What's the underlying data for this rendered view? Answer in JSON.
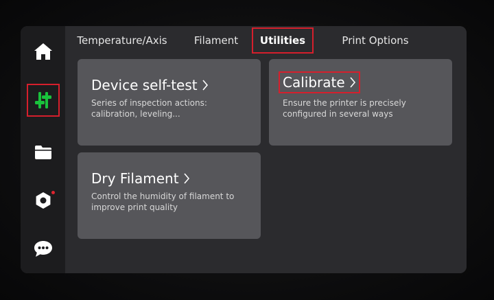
{
  "sidebar": {
    "items": [
      {
        "icon": "home-icon"
      },
      {
        "icon": "sliders-icon",
        "highlighted": true,
        "accent": "#19c23c"
      },
      {
        "icon": "folder-icon"
      },
      {
        "icon": "settings-hex-icon",
        "notification": true
      },
      {
        "icon": "chat-icon"
      }
    ]
  },
  "tabs": [
    {
      "label": "Temperature/Axis"
    },
    {
      "label": "Filament"
    },
    {
      "label": "Utilities",
      "active": true
    },
    {
      "label": "Print Options"
    }
  ],
  "cards": {
    "self_test": {
      "title": "Device self-test",
      "description": "Series of inspection actions: calibration, leveling..."
    },
    "calibrate": {
      "title": "Calibrate",
      "description": "Ensure the printer is precisely configured in several ways"
    },
    "dry_filament": {
      "title": "Dry Filament",
      "description": "Control the humidity of filament to improve print quality"
    }
  },
  "colors": {
    "highlight": "#d61f2c",
    "accent_green": "#19c23c",
    "card_bg": "#56565a",
    "screen_bg": "#2b2b2e",
    "sidebar_bg": "#1c1c1e"
  }
}
